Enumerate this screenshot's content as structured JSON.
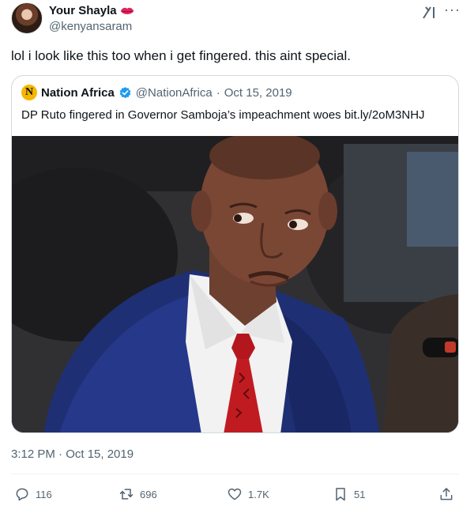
{
  "user": {
    "display_name": "Your Shayla",
    "handle": "@kenyansaram"
  },
  "tweet": {
    "text": "lol i look like this too when i get fingered. this aint special.",
    "timestamp": "3:12 PM · Oct 15, 2019"
  },
  "quote": {
    "logo_letter": "N",
    "name": "Nation Africa",
    "handle": "@NationAfrica",
    "separator": "·",
    "date": "Oct 15, 2019",
    "text": "DP Ruto fingered in Governor Samboja’s impeachment woes bit.ly/2oM3NHJ"
  },
  "actions": {
    "replies": "116",
    "retweets": "696",
    "likes": "1.7K",
    "bookmarks": "51"
  },
  "icons": {
    "header": [
      "lips-emoji-icon",
      "grok-icon",
      "more-icon"
    ],
    "verified": "verified-badge-icon",
    "actions": [
      "reply-icon",
      "retweet-icon",
      "like-icon",
      "bookmark-icon",
      "share-icon"
    ]
  },
  "colors": {
    "text": "#0f1419",
    "secondary": "#536471",
    "border": "#cfd9de",
    "verified_blue": "#1d9bf0",
    "nation_logo": "#f5b700",
    "lips": "#e0245e"
  }
}
